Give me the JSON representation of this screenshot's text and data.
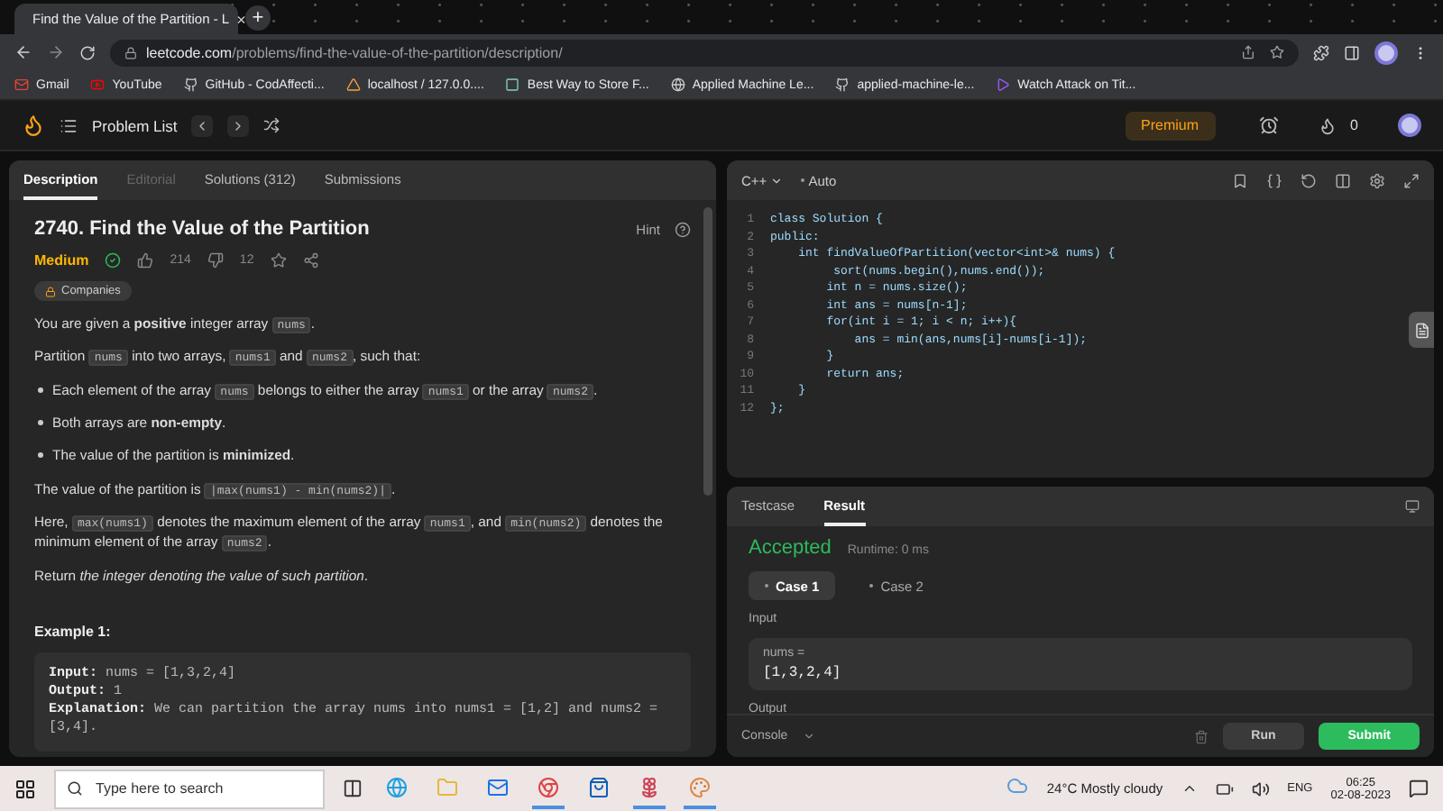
{
  "browser": {
    "tab": {
      "title": "Find the Value of the Partition - L",
      "close": "×"
    },
    "new_tab": "+",
    "url": {
      "domain": "leetcode.com",
      "path": "/problems/find-the-value-of-the-partition/description/"
    },
    "bookmarks": [
      "Gmail",
      "YouTube",
      "GitHub - CodAffecti...",
      "localhost / 127.0.0....",
      "Best Way to Store F...",
      "Applied Machine Le...",
      "applied-machine-le...",
      "Watch Attack on Tit..."
    ]
  },
  "nav": {
    "problem_list": "Problem List",
    "premium": "Premium",
    "streak": "0"
  },
  "description": {
    "tabs": [
      {
        "label": "Description",
        "selected": true,
        "disabled": false
      },
      {
        "label": "Editorial",
        "selected": false,
        "disabled": true
      },
      {
        "label": "Solutions (312)",
        "selected": false,
        "disabled": false
      },
      {
        "label": "Submissions",
        "selected": false,
        "disabled": false
      }
    ],
    "title": "2740. Find the Value of the Partition",
    "hint": "Hint",
    "difficulty": "Medium",
    "solved": true,
    "likes": "214",
    "dislikes": "12",
    "companies": "Companies",
    "paragraphs": [
      {
        "kind": "para",
        "parts": [
          {
            "kind": "text",
            "text": "You are given a "
          },
          {
            "kind": "bold",
            "text": "positive"
          },
          {
            "kind": "text",
            "text": " integer array "
          },
          {
            "kind": "code",
            "text": "nums"
          },
          {
            "kind": "text",
            "text": "."
          }
        ]
      },
      {
        "kind": "para",
        "parts": [
          {
            "kind": "text",
            "text": "Partition "
          },
          {
            "kind": "code",
            "text": "nums"
          },
          {
            "kind": "text",
            "text": " into two arrays, "
          },
          {
            "kind": "code",
            "text": "nums1"
          },
          {
            "kind": "text",
            "text": " and "
          },
          {
            "kind": "code",
            "text": "nums2"
          },
          {
            "kind": "text",
            "text": ", such that:"
          }
        ]
      },
      {
        "kind": "bullet",
        "parts": [
          {
            "kind": "text",
            "text": "Each element of the array "
          },
          {
            "kind": "code",
            "text": "nums"
          },
          {
            "kind": "text",
            "text": " belongs to either the array "
          },
          {
            "kind": "code",
            "text": "nums1"
          },
          {
            "kind": "text",
            "text": " or the array "
          },
          {
            "kind": "code",
            "text": "nums2"
          },
          {
            "kind": "text",
            "text": "."
          }
        ]
      },
      {
        "kind": "bullet",
        "parts": [
          {
            "kind": "text",
            "text": "Both arrays are "
          },
          {
            "kind": "bold",
            "text": "non-empty"
          },
          {
            "kind": "text",
            "text": "."
          }
        ]
      },
      {
        "kind": "bullet",
        "parts": [
          {
            "kind": "text",
            "text": "The value of the partition is "
          },
          {
            "kind": "bold",
            "text": "minimized"
          },
          {
            "kind": "text",
            "text": "."
          }
        ]
      },
      {
        "kind": "para",
        "parts": [
          {
            "kind": "text",
            "text": "The value of the partition is "
          },
          {
            "kind": "code",
            "text": "|max(nums1) - min(nums2)|"
          },
          {
            "kind": "text",
            "text": "."
          }
        ]
      },
      {
        "kind": "para",
        "parts": [
          {
            "kind": "text",
            "text": "Here, "
          },
          {
            "kind": "code",
            "text": "max(nums1)"
          },
          {
            "kind": "text",
            "text": " denotes the maximum element of the array "
          },
          {
            "kind": "code",
            "text": "nums1"
          },
          {
            "kind": "text",
            "text": ", and "
          },
          {
            "kind": "code",
            "text": "min(nums2)"
          },
          {
            "kind": "text",
            "text": " denotes the minimum element of the array "
          },
          {
            "kind": "code",
            "text": "nums2"
          },
          {
            "kind": "text",
            "text": "."
          }
        ]
      },
      {
        "kind": "para",
        "parts": [
          {
            "kind": "text",
            "text": "Return "
          },
          {
            "kind": "italic",
            "text": "the integer denoting the value of such partition"
          },
          {
            "kind": "text",
            "text": "."
          }
        ]
      }
    ],
    "example": {
      "heading": "Example 1:",
      "lines": [
        {
          "label": "Input:",
          "value": " nums = [1,3,2,4]"
        },
        {
          "label": "Output:",
          "value": " 1"
        },
        {
          "label": "Explanation:",
          "value": " We can partition the array nums into nums1 = [1,2] and nums2 = [3,4]."
        }
      ]
    }
  },
  "editor": {
    "language": "C++",
    "mode": "Auto",
    "lines": [
      {
        "n": "1",
        "code": "class Solution {"
      },
      {
        "n": "2",
        "code": "public:"
      },
      {
        "n": "3",
        "code": "    int findValueOfPartition(vector<int>& nums) {"
      },
      {
        "n": "4",
        "code": "         sort(nums.begin(),nums.end());"
      },
      {
        "n": "5",
        "code": "        int n = nums.size();"
      },
      {
        "n": "6",
        "code": "        int ans = nums[n-1];"
      },
      {
        "n": "7",
        "code": "        for(int i = 1; i < n; i++){"
      },
      {
        "n": "8",
        "code": "            ans = min(ans,nums[i]-nums[i-1]);"
      },
      {
        "n": "9",
        "code": "        }"
      },
      {
        "n": "10",
        "code": "        return ans;"
      },
      {
        "n": "11",
        "code": "    }"
      },
      {
        "n": "12",
        "code": "};"
      }
    ]
  },
  "result": {
    "tabs": [
      {
        "label": "Testcase",
        "selected": false
      },
      {
        "label": "Result",
        "selected": true
      }
    ],
    "status": "Accepted",
    "runtime": "Runtime: 0 ms",
    "cases": [
      {
        "label": "Case 1",
        "selected": true
      },
      {
        "label": "Case 2",
        "selected": false
      }
    ],
    "input_label": "Input",
    "variable": "nums =",
    "value": "[1,3,2,4]",
    "output_label": "Output",
    "console": "Console",
    "run": "Run",
    "submit": "Submit"
  },
  "taskbar": {
    "search_placeholder": "Type here to search",
    "apps": [
      {
        "running": false
      },
      {
        "running": false
      },
      {
        "running": false
      },
      {
        "running": true
      },
      {
        "running": false
      },
      {
        "running": true
      },
      {
        "running": true
      }
    ],
    "weather": "24°C  Mostly cloudy",
    "language": "ENG",
    "time": "06:25",
    "date": "02-08-2023"
  }
}
